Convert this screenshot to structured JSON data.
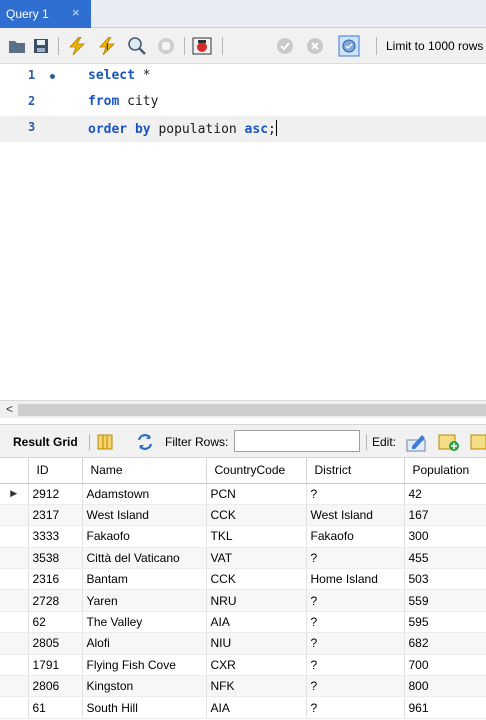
{
  "tab": {
    "label": "Query 1",
    "close_glyph": "×"
  },
  "toolbar": {
    "icons": [
      "open-folder-icon",
      "save-icon",
      "execute-lightning-icon",
      "execute-current-icon",
      "explain-magnifier-icon",
      "stop-hand-icon",
      "toggle-error-icon",
      "commit-check-icon",
      "rollback-x-icon",
      "autocommit-icon"
    ],
    "limit_label": "Limit to 1000 rows"
  },
  "editor": {
    "lines": [
      {
        "number": "1",
        "tokens": [
          {
            "t": "select",
            "kw": true
          },
          {
            "t": " *",
            "kw": false
          }
        ]
      },
      {
        "number": "2",
        "tokens": [
          {
            "t": "from",
            "kw": true
          },
          {
            "t": " city",
            "kw": false
          }
        ]
      },
      {
        "number": "3",
        "tokens": [
          {
            "t": "order by",
            "kw": true
          },
          {
            "t": " population ",
            "kw": false
          },
          {
            "t": "asc",
            "kw": true
          },
          {
            "t": ";",
            "kw": false
          }
        ]
      }
    ]
  },
  "scrollbar": {
    "left_arrow": "<"
  },
  "result_toolbar": {
    "result_grid_label": "Result Grid",
    "filter_label": "Filter Rows:",
    "filter_value": "",
    "edit_label": "Edit:"
  },
  "grid": {
    "columns": [
      "ID",
      "Name",
      "CountryCode",
      "District",
      "Population"
    ],
    "selected_marker": "▶",
    "rows": [
      [
        "2912",
        "Adamstown",
        "PCN",
        "?",
        "42"
      ],
      [
        "2317",
        "West Island",
        "CCK",
        "West Island",
        "167"
      ],
      [
        "3333",
        "Fakaofo",
        "TKL",
        "Fakaofo",
        "300"
      ],
      [
        "3538",
        "Città del Vaticano",
        "VAT",
        "?",
        "455"
      ],
      [
        "2316",
        "Bantam",
        "CCK",
        "Home Island",
        "503"
      ],
      [
        "2728",
        "Yaren",
        "NRU",
        "?",
        "559"
      ],
      [
        "62",
        "The Valley",
        "AIA",
        "?",
        "595"
      ],
      [
        "2805",
        "Alofi",
        "NIU",
        "?",
        "682"
      ],
      [
        "1791",
        "Flying Fish Cove",
        "CXR",
        "?",
        "700"
      ],
      [
        "2806",
        "Kingston",
        "NFK",
        "?",
        "800"
      ],
      [
        "61",
        "South Hill",
        "AIA",
        "?",
        "961"
      ]
    ]
  }
}
